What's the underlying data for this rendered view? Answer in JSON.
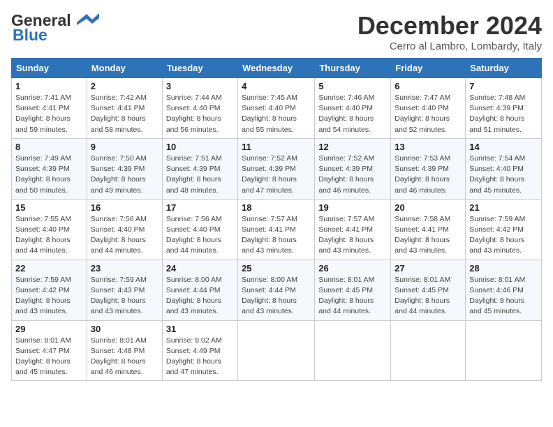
{
  "logo": {
    "line1": "General",
    "line2": "Blue"
  },
  "title": "December 2024",
  "location": "Cerro al Lambro, Lombardy, Italy",
  "days_of_week": [
    "Sunday",
    "Monday",
    "Tuesday",
    "Wednesday",
    "Thursday",
    "Friday",
    "Saturday"
  ],
  "weeks": [
    [
      {
        "day": "1",
        "rise": "7:41 AM",
        "set": "4:41 PM",
        "daylight": "8 hours and 59 minutes."
      },
      {
        "day": "2",
        "rise": "7:42 AM",
        "set": "4:41 PM",
        "daylight": "8 hours and 58 minutes."
      },
      {
        "day": "3",
        "rise": "7:44 AM",
        "set": "4:40 PM",
        "daylight": "8 hours and 56 minutes."
      },
      {
        "day": "4",
        "rise": "7:45 AM",
        "set": "4:40 PM",
        "daylight": "8 hours and 55 minutes."
      },
      {
        "day": "5",
        "rise": "7:46 AM",
        "set": "4:40 PM",
        "daylight": "8 hours and 54 minutes."
      },
      {
        "day": "6",
        "rise": "7:47 AM",
        "set": "4:40 PM",
        "daylight": "8 hours and 52 minutes."
      },
      {
        "day": "7",
        "rise": "7:48 AM",
        "set": "4:39 PM",
        "daylight": "8 hours and 51 minutes."
      }
    ],
    [
      {
        "day": "8",
        "rise": "7:49 AM",
        "set": "4:39 PM",
        "daylight": "8 hours and 50 minutes."
      },
      {
        "day": "9",
        "rise": "7:50 AM",
        "set": "4:39 PM",
        "daylight": "8 hours and 49 minutes."
      },
      {
        "day": "10",
        "rise": "7:51 AM",
        "set": "4:39 PM",
        "daylight": "8 hours and 48 minutes."
      },
      {
        "day": "11",
        "rise": "7:52 AM",
        "set": "4:39 PM",
        "daylight": "8 hours and 47 minutes."
      },
      {
        "day": "12",
        "rise": "7:52 AM",
        "set": "4:39 PM",
        "daylight": "8 hours and 46 minutes."
      },
      {
        "day": "13",
        "rise": "7:53 AM",
        "set": "4:39 PM",
        "daylight": "8 hours and 46 minutes."
      },
      {
        "day": "14",
        "rise": "7:54 AM",
        "set": "4:40 PM",
        "daylight": "8 hours and 45 minutes."
      }
    ],
    [
      {
        "day": "15",
        "rise": "7:55 AM",
        "set": "4:40 PM",
        "daylight": "8 hours and 44 minutes."
      },
      {
        "day": "16",
        "rise": "7:56 AM",
        "set": "4:40 PM",
        "daylight": "8 hours and 44 minutes."
      },
      {
        "day": "17",
        "rise": "7:56 AM",
        "set": "4:40 PM",
        "daylight": "8 hours and 44 minutes."
      },
      {
        "day": "18",
        "rise": "7:57 AM",
        "set": "4:41 PM",
        "daylight": "8 hours and 43 minutes."
      },
      {
        "day": "19",
        "rise": "7:57 AM",
        "set": "4:41 PM",
        "daylight": "8 hours and 43 minutes."
      },
      {
        "day": "20",
        "rise": "7:58 AM",
        "set": "4:41 PM",
        "daylight": "8 hours and 43 minutes."
      },
      {
        "day": "21",
        "rise": "7:59 AM",
        "set": "4:42 PM",
        "daylight": "8 hours and 43 minutes."
      }
    ],
    [
      {
        "day": "22",
        "rise": "7:59 AM",
        "set": "4:42 PM",
        "daylight": "8 hours and 43 minutes."
      },
      {
        "day": "23",
        "rise": "7:59 AM",
        "set": "4:43 PM",
        "daylight": "8 hours and 43 minutes."
      },
      {
        "day": "24",
        "rise": "8:00 AM",
        "set": "4:44 PM",
        "daylight": "8 hours and 43 minutes."
      },
      {
        "day": "25",
        "rise": "8:00 AM",
        "set": "4:44 PM",
        "daylight": "8 hours and 43 minutes."
      },
      {
        "day": "26",
        "rise": "8:01 AM",
        "set": "4:45 PM",
        "daylight": "8 hours and 44 minutes."
      },
      {
        "day": "27",
        "rise": "8:01 AM",
        "set": "4:45 PM",
        "daylight": "8 hours and 44 minutes."
      },
      {
        "day": "28",
        "rise": "8:01 AM",
        "set": "4:46 PM",
        "daylight": "8 hours and 45 minutes."
      }
    ],
    [
      {
        "day": "29",
        "rise": "8:01 AM",
        "set": "4:47 PM",
        "daylight": "8 hours and 45 minutes."
      },
      {
        "day": "30",
        "rise": "8:01 AM",
        "set": "4:48 PM",
        "daylight": "8 hours and 46 minutes."
      },
      {
        "day": "31",
        "rise": "8:02 AM",
        "set": "4:49 PM",
        "daylight": "8 hours and 47 minutes."
      },
      null,
      null,
      null,
      null
    ]
  ],
  "labels": {
    "sunrise": "Sunrise:",
    "sunset": "Sunset:",
    "daylight": "Daylight:"
  }
}
